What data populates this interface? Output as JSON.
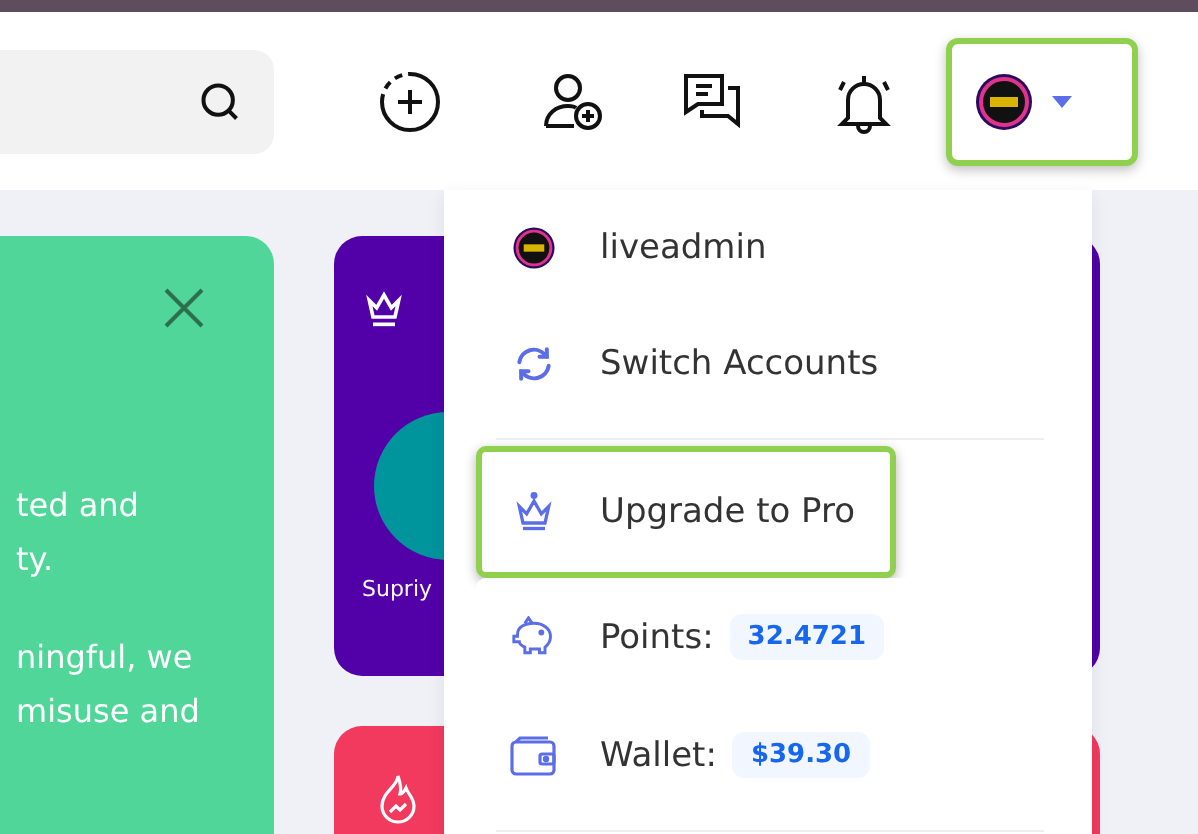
{
  "header": {
    "avatar_button": {
      "highlighted": true
    }
  },
  "welcome_card": {
    "paragraphs": [
      [
        "ted and",
        "ty."
      ],
      [
        "ningful, we",
        "misuse and"
      ]
    ]
  },
  "profile_card": {
    "name": "Supriy"
  },
  "account_menu": {
    "items": [
      {
        "kind": "profile",
        "label": "liveadmin",
        "highlighted": false
      },
      {
        "kind": "switch",
        "label": "Switch Accounts",
        "highlighted": false
      },
      {
        "kind": "upgrade",
        "label": "Upgrade to Pro",
        "highlighted": true
      },
      {
        "kind": "points",
        "label": "Points:",
        "value": "32.4721",
        "highlighted": false
      },
      {
        "kind": "wallet",
        "label": "Wallet:",
        "value": "$39.30",
        "highlighted": false
      }
    ]
  }
}
